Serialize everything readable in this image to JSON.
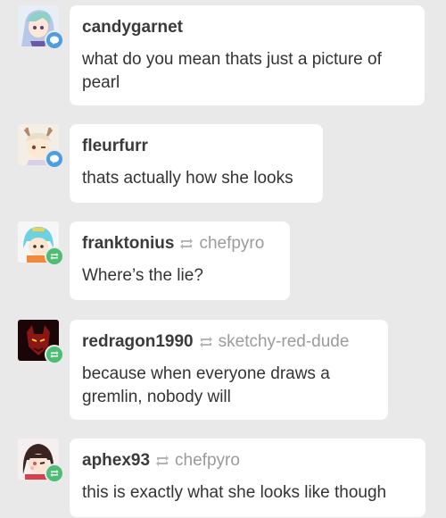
{
  "colors": {
    "reply_badge": "#4d9de0",
    "reblog_badge": "#4cbd72",
    "text": "#333333",
    "muted": "#9b9b9b",
    "background": "#e9e9e9",
    "bubble": "#ffffff"
  },
  "notes": [
    {
      "user": "candygarnet",
      "type": "reply",
      "badge_icon": "speech-bubble-icon",
      "source": "",
      "text": "what do you mean thats just a picture of pearl"
    },
    {
      "user": "fleurfurr",
      "type": "reply",
      "badge_icon": "speech-bubble-icon",
      "source": "",
      "text": "thats actually how she looks"
    },
    {
      "user": "franktonius",
      "type": "reblog",
      "badge_icon": "reblog-icon",
      "source": "chefpyro",
      "text": "Where’s the lie?"
    },
    {
      "user": "redragon1990",
      "type": "reblog",
      "badge_icon": "reblog-icon",
      "source": "sketchy-red-dude",
      "text": "because when everyone draws a gremlin, nobody will"
    },
    {
      "user": "aphex93",
      "type": "reblog",
      "badge_icon": "reblog-icon",
      "source": "chefpyro",
      "text": "this is exactly what she looks like though"
    }
  ]
}
